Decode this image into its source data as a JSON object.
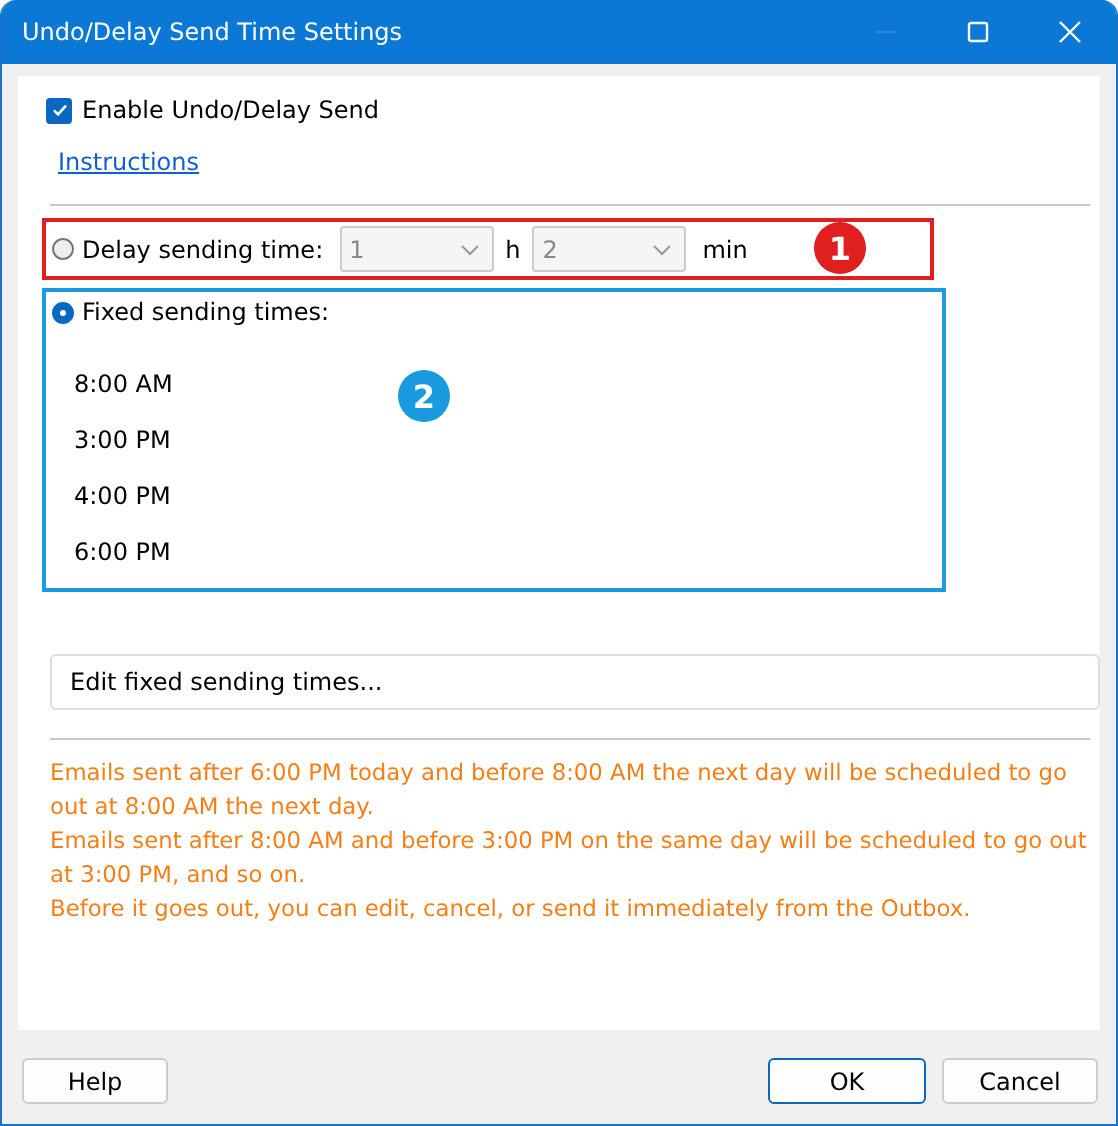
{
  "window": {
    "title": "Undo/Delay Send Time Settings",
    "controls": [
      {
        "kind": "minimize",
        "disabled": true
      },
      {
        "kind": "maximize",
        "disabled": false
      },
      {
        "kind": "close",
        "disabled": false
      }
    ]
  },
  "enable": {
    "label": "Enable Undo/Delay Send",
    "checked": true
  },
  "instructions_link": "Instructions",
  "delay": {
    "label": "Delay sending time:",
    "selected": false,
    "hours": "1",
    "hours_unit": "h",
    "minutes": "2",
    "minutes_unit": "min",
    "disabled": true,
    "callout": {
      "text": "1",
      "color": "#e02020"
    }
  },
  "fixed": {
    "label": "Fixed sending times:",
    "selected": true,
    "times": [
      "8:00 AM",
      "3:00 PM",
      "4:00 PM",
      "6:00 PM"
    ],
    "callout": {
      "text": "2",
      "color": "#1a9be0"
    }
  },
  "edit_button": "Edit fixed sending times...",
  "notes": [
    "Emails sent after 6:00 PM today and before 8:00 AM the next day will be scheduled to go out at 8:00 AM the next day.",
    "Emails sent after 8:00 AM and before 3:00 PM on the same day will be scheduled to go out at 3:00 PM, and so on.",
    "Before it goes out, you can edit, cancel, or send it immediately from the Outbox."
  ],
  "buttons": {
    "help": "Help",
    "ok": "OK",
    "cancel": "Cancel"
  }
}
